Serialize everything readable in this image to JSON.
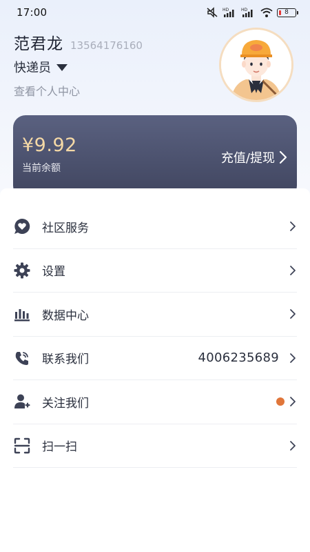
{
  "status_bar": {
    "time": "17:00",
    "battery": "8"
  },
  "profile": {
    "name": "范君龙",
    "phone": "13564176160",
    "role": "快递员",
    "profile_link": "查看个人中心"
  },
  "balance": {
    "amount": "¥9.92",
    "label": "当前余额",
    "recharge_label": "充值/提现"
  },
  "menu": {
    "items": [
      {
        "label": "社区服务",
        "icon": "heart-chat-icon"
      },
      {
        "label": "设置",
        "icon": "gear-icon"
      },
      {
        "label": "数据中心",
        "icon": "bar-chart-icon"
      },
      {
        "label": "联系我们",
        "icon": "phone-icon",
        "value": "4006235689"
      },
      {
        "label": "关注我们",
        "icon": "user-add-icon",
        "badge_color": "#e0763a"
      },
      {
        "label": "扫一扫",
        "icon": "scan-icon"
      }
    ]
  },
  "colors": {
    "accent_gold": "#f5d9a6",
    "card": "#4a4f6b",
    "icon": "#3d4256"
  }
}
